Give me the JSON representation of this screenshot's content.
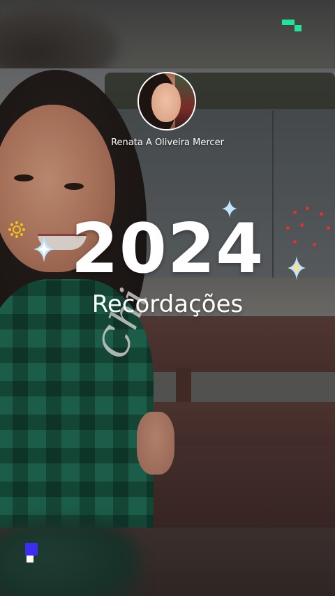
{
  "profile": {
    "name": "Renata A Oliveira Mercer"
  },
  "title": {
    "year": "2024",
    "subtitle": "Recordações"
  },
  "shirt": {
    "text": "Chi"
  },
  "colors": {
    "logo_accent": "#22e39c",
    "bottom_logo_blue": "#3b2ef0",
    "sparkle_red": "#e0322f",
    "sun_yellow": "#f2c21b"
  },
  "icons": {
    "top_logo": "app-logo-icon",
    "bottom_logo": "watermark-icon",
    "sparkle": "sparkle-icon",
    "sun": "sun-icon"
  }
}
